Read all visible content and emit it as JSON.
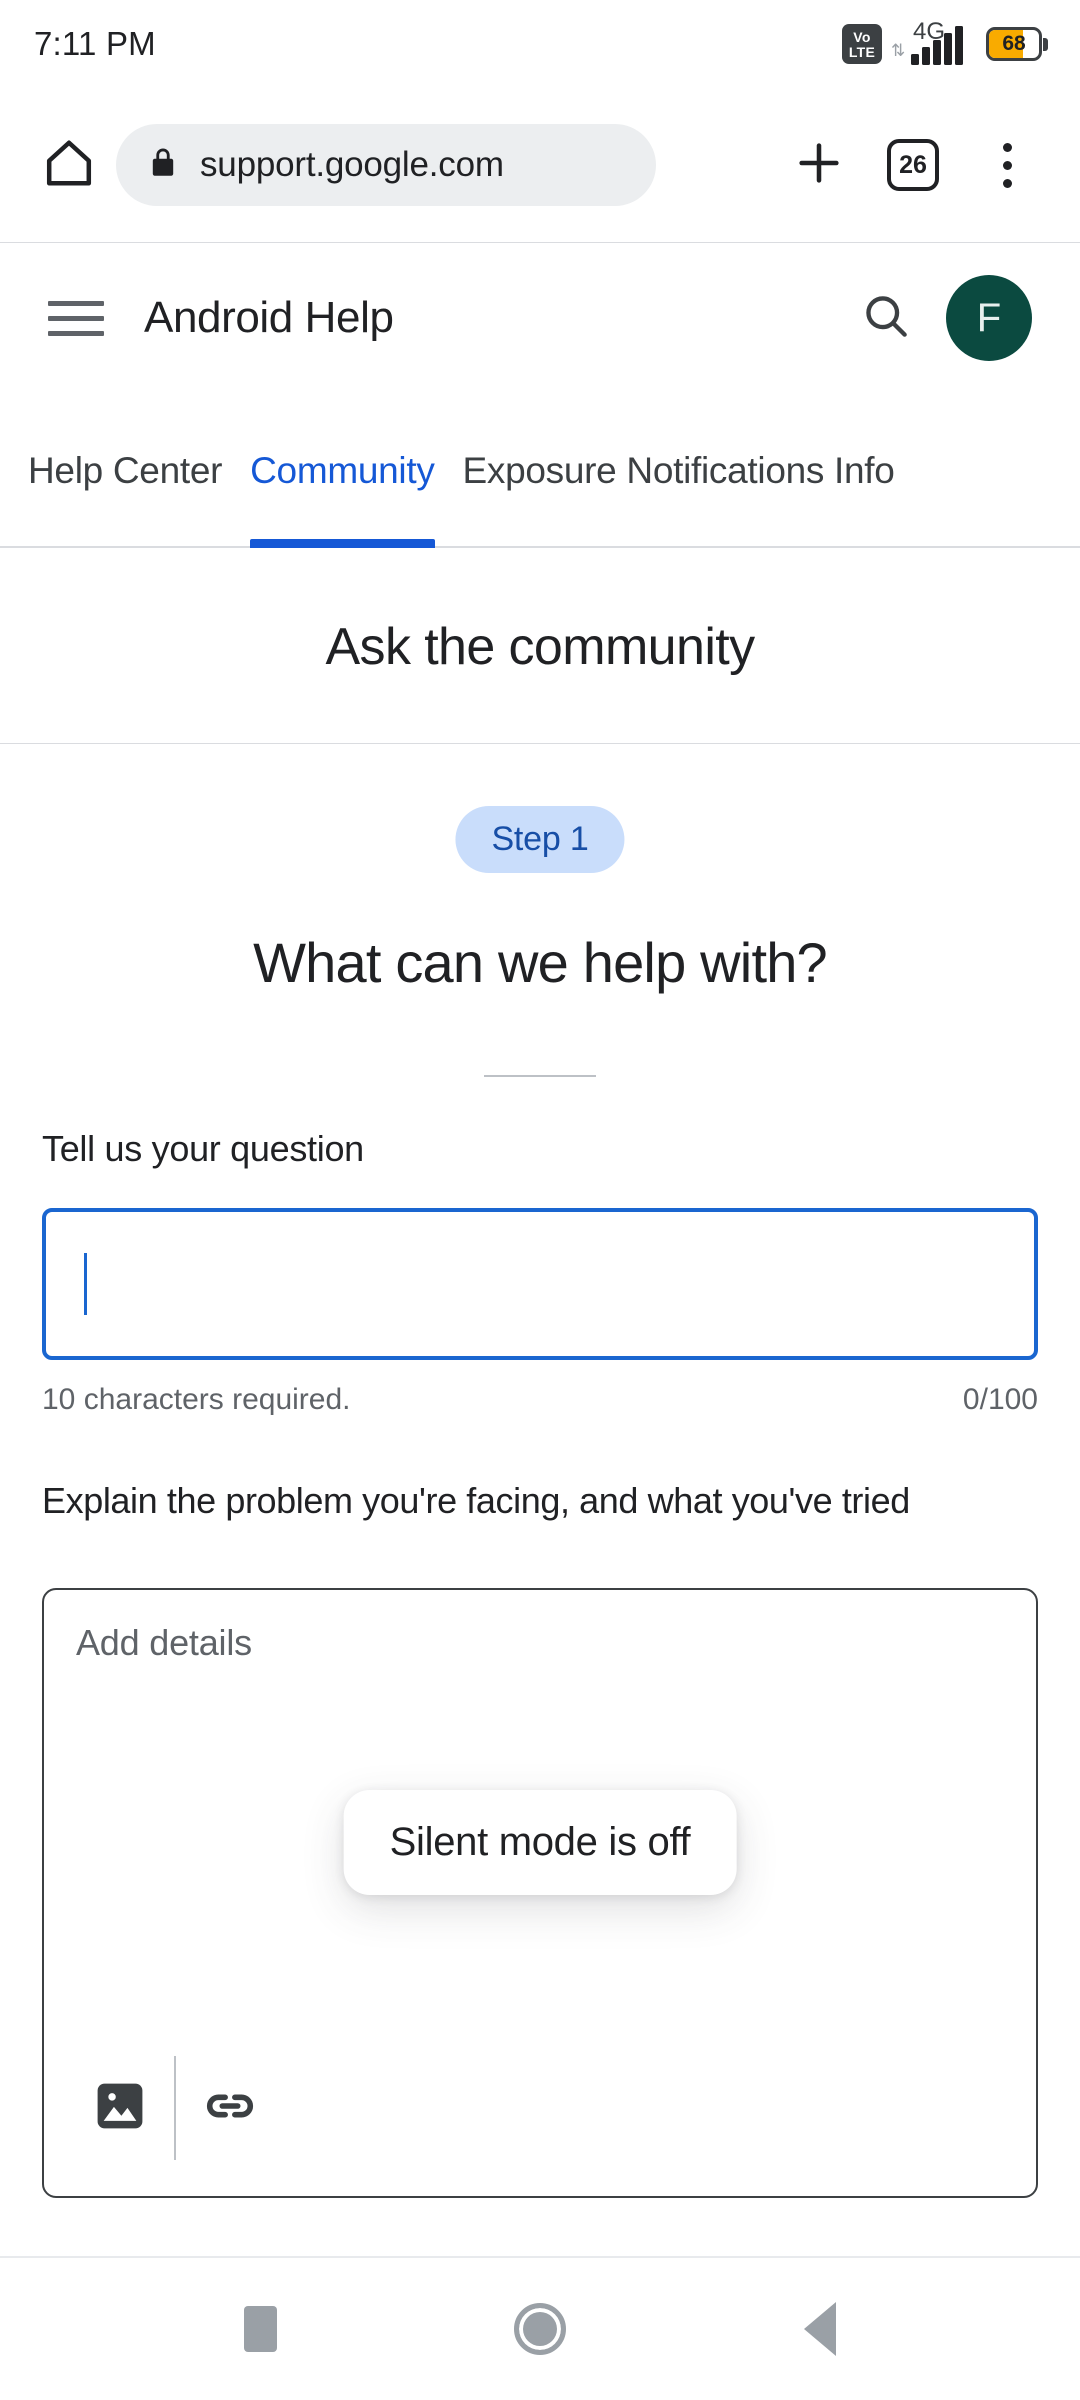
{
  "status_bar": {
    "time": "7:11 PM",
    "volte_top": "Vo",
    "volte_bottom": "LTE",
    "network_type": "4G",
    "battery_percent": "68"
  },
  "browser": {
    "url": "support.google.com",
    "tab_count": "26",
    "home_icon": "home-icon",
    "lock_icon": "lock-icon",
    "new_tab_icon": "plus-icon",
    "menu_icon": "three-dot-menu-icon"
  },
  "app_header": {
    "title": "Android Help",
    "menu_icon": "hamburger-icon",
    "search_icon": "search-icon",
    "avatar_initial": "F",
    "avatar_color": "#0b4a40"
  },
  "tabs": [
    {
      "label": "Help Center",
      "active": false
    },
    {
      "label": "Community",
      "active": true
    },
    {
      "label": "Exposure Notifications Info",
      "active": false
    }
  ],
  "page": {
    "section_title": "Ask the community",
    "step_badge": "Step 1",
    "step_heading": "What can we help with?"
  },
  "question_field": {
    "label": "Tell us your question",
    "value": "",
    "hint_left": "10 characters required.",
    "hint_right": "0/100",
    "border_color": "#1a66d0"
  },
  "details_field": {
    "label": "Explain the problem you're facing, and what you've tried",
    "placeholder": "Add details",
    "value": "",
    "toolbar": [
      {
        "name": "insert-image-icon",
        "label": "Insert image"
      },
      {
        "name": "insert-link-icon",
        "label": "Insert link"
      }
    ]
  },
  "toast": {
    "message": "Silent mode is off"
  },
  "nav_bar": {
    "recents_label": "Recents",
    "home_label": "Home",
    "back_label": "Back"
  },
  "colors": {
    "accent_blue": "#1558d6",
    "step_pill_bg": "#c9ddfb",
    "step_pill_text": "#174ea6",
    "battery_fill": "#f9ab00"
  }
}
